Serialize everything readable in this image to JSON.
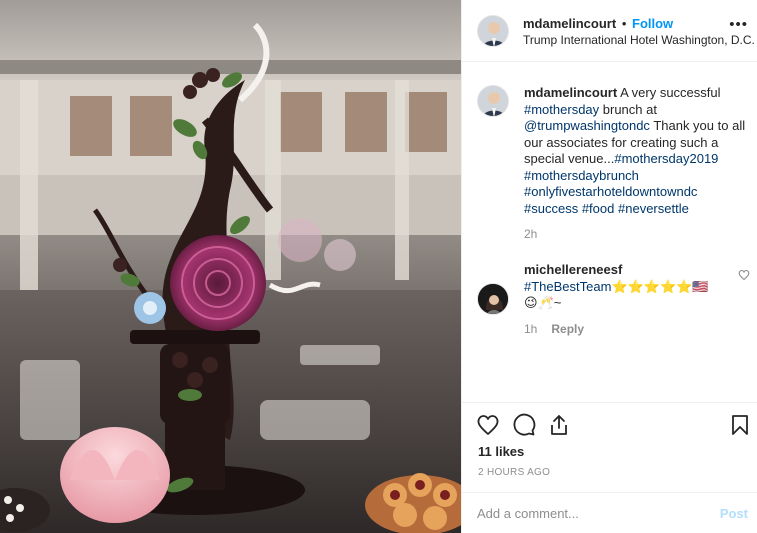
{
  "post": {
    "username": "mdamelincourt",
    "follow_label": "Follow",
    "separator": "•",
    "location": "Trump International Hotel Washington, D.C.",
    "more_glyph": "•••"
  },
  "caption": {
    "username": "mdamelincourt",
    "text_1": " A very successful ",
    "tag_1": "#mothersday",
    "text_2": " brunch at ",
    "tag_2": "@trumpwashingtondc",
    "text_3": " Thank you to all our associates for creating such a special venue...",
    "tag_3": "#mothersday2019",
    "tag_4": "#mothersdaybrunch",
    "tag_5": "#onlyfivestarhoteldowntowndc",
    "tag_6": "#success",
    "tag_7": "#food",
    "tag_8": "#neversettle",
    "time": "2h"
  },
  "comment": {
    "username": "michellereneesf",
    "tag": "#TheBestTeam",
    "emojis_1": "⭐⭐⭐⭐⭐🇺🇸",
    "emojis_2": "😉🥂~",
    "time": "1h",
    "reply_label": "Reply"
  },
  "actions": {
    "likes": "11 likes",
    "time_ago": "2 HOURS AGO"
  },
  "add_comment": {
    "placeholder": "Add a comment...",
    "post_label": "Post"
  },
  "icons": [
    "heart-icon",
    "comment-icon",
    "share-icon",
    "bookmark-icon",
    "more-options-icon",
    "heart-small-icon"
  ],
  "colors": {
    "follow_blue": "#0095f6",
    "hashtag_blue": "#00376b",
    "post_disabled": "#b2dffc",
    "muted": "#8e8e8e"
  }
}
